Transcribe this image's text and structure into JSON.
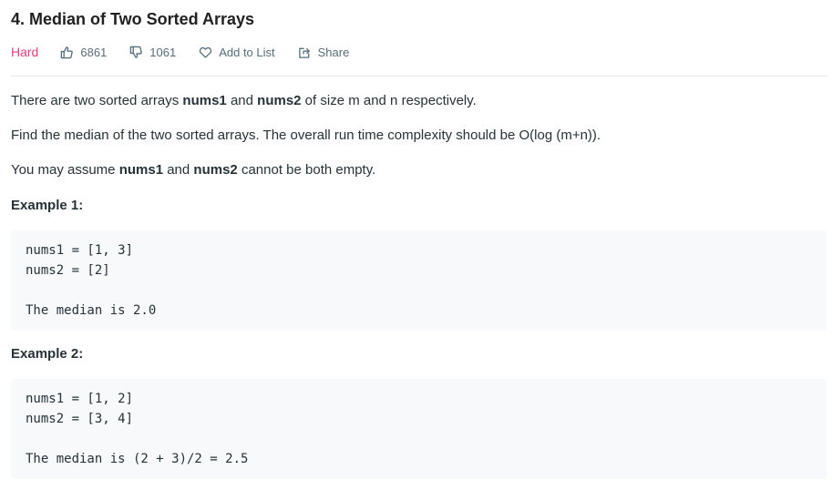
{
  "problem": {
    "title": "4. Median of Two Sorted Arrays",
    "difficulty": "Hard",
    "likes": "6861",
    "dislikes": "1061",
    "add_to_list": "Add to List",
    "share": "Share"
  },
  "description": {
    "p1": {
      "pre": "There are two sorted arrays ",
      "a": "nums1",
      "mid": " and ",
      "b": "nums2",
      "post": " of size m and n respectively."
    },
    "p2": "Find the median of the two sorted arrays. The overall run time complexity should be O(log (m+n)).",
    "p3": {
      "pre": "You may assume ",
      "a": "nums1",
      "mid": " and ",
      "b": "nums2",
      "post": " cannot be both empty."
    }
  },
  "examples": [
    {
      "title": "Example 1:",
      "code": "nums1 = [1, 3]\nnums2 = [2]\n\nThe median is 2.0"
    },
    {
      "title": "Example 2:",
      "code": "nums1 = [1, 2]\nnums2 = [3, 4]\n\nThe median is (2 + 3)/2 = 2.5"
    }
  ],
  "colors": {
    "difficulty_hard": "#ec407a",
    "text": "#263238",
    "meta": "#546e7a",
    "code_bg": "#f7f9fa"
  },
  "icons": {
    "like": "thumbs-up-icon",
    "dislike": "thumbs-down-icon",
    "add_to_list": "heart-icon",
    "share": "share-icon"
  }
}
